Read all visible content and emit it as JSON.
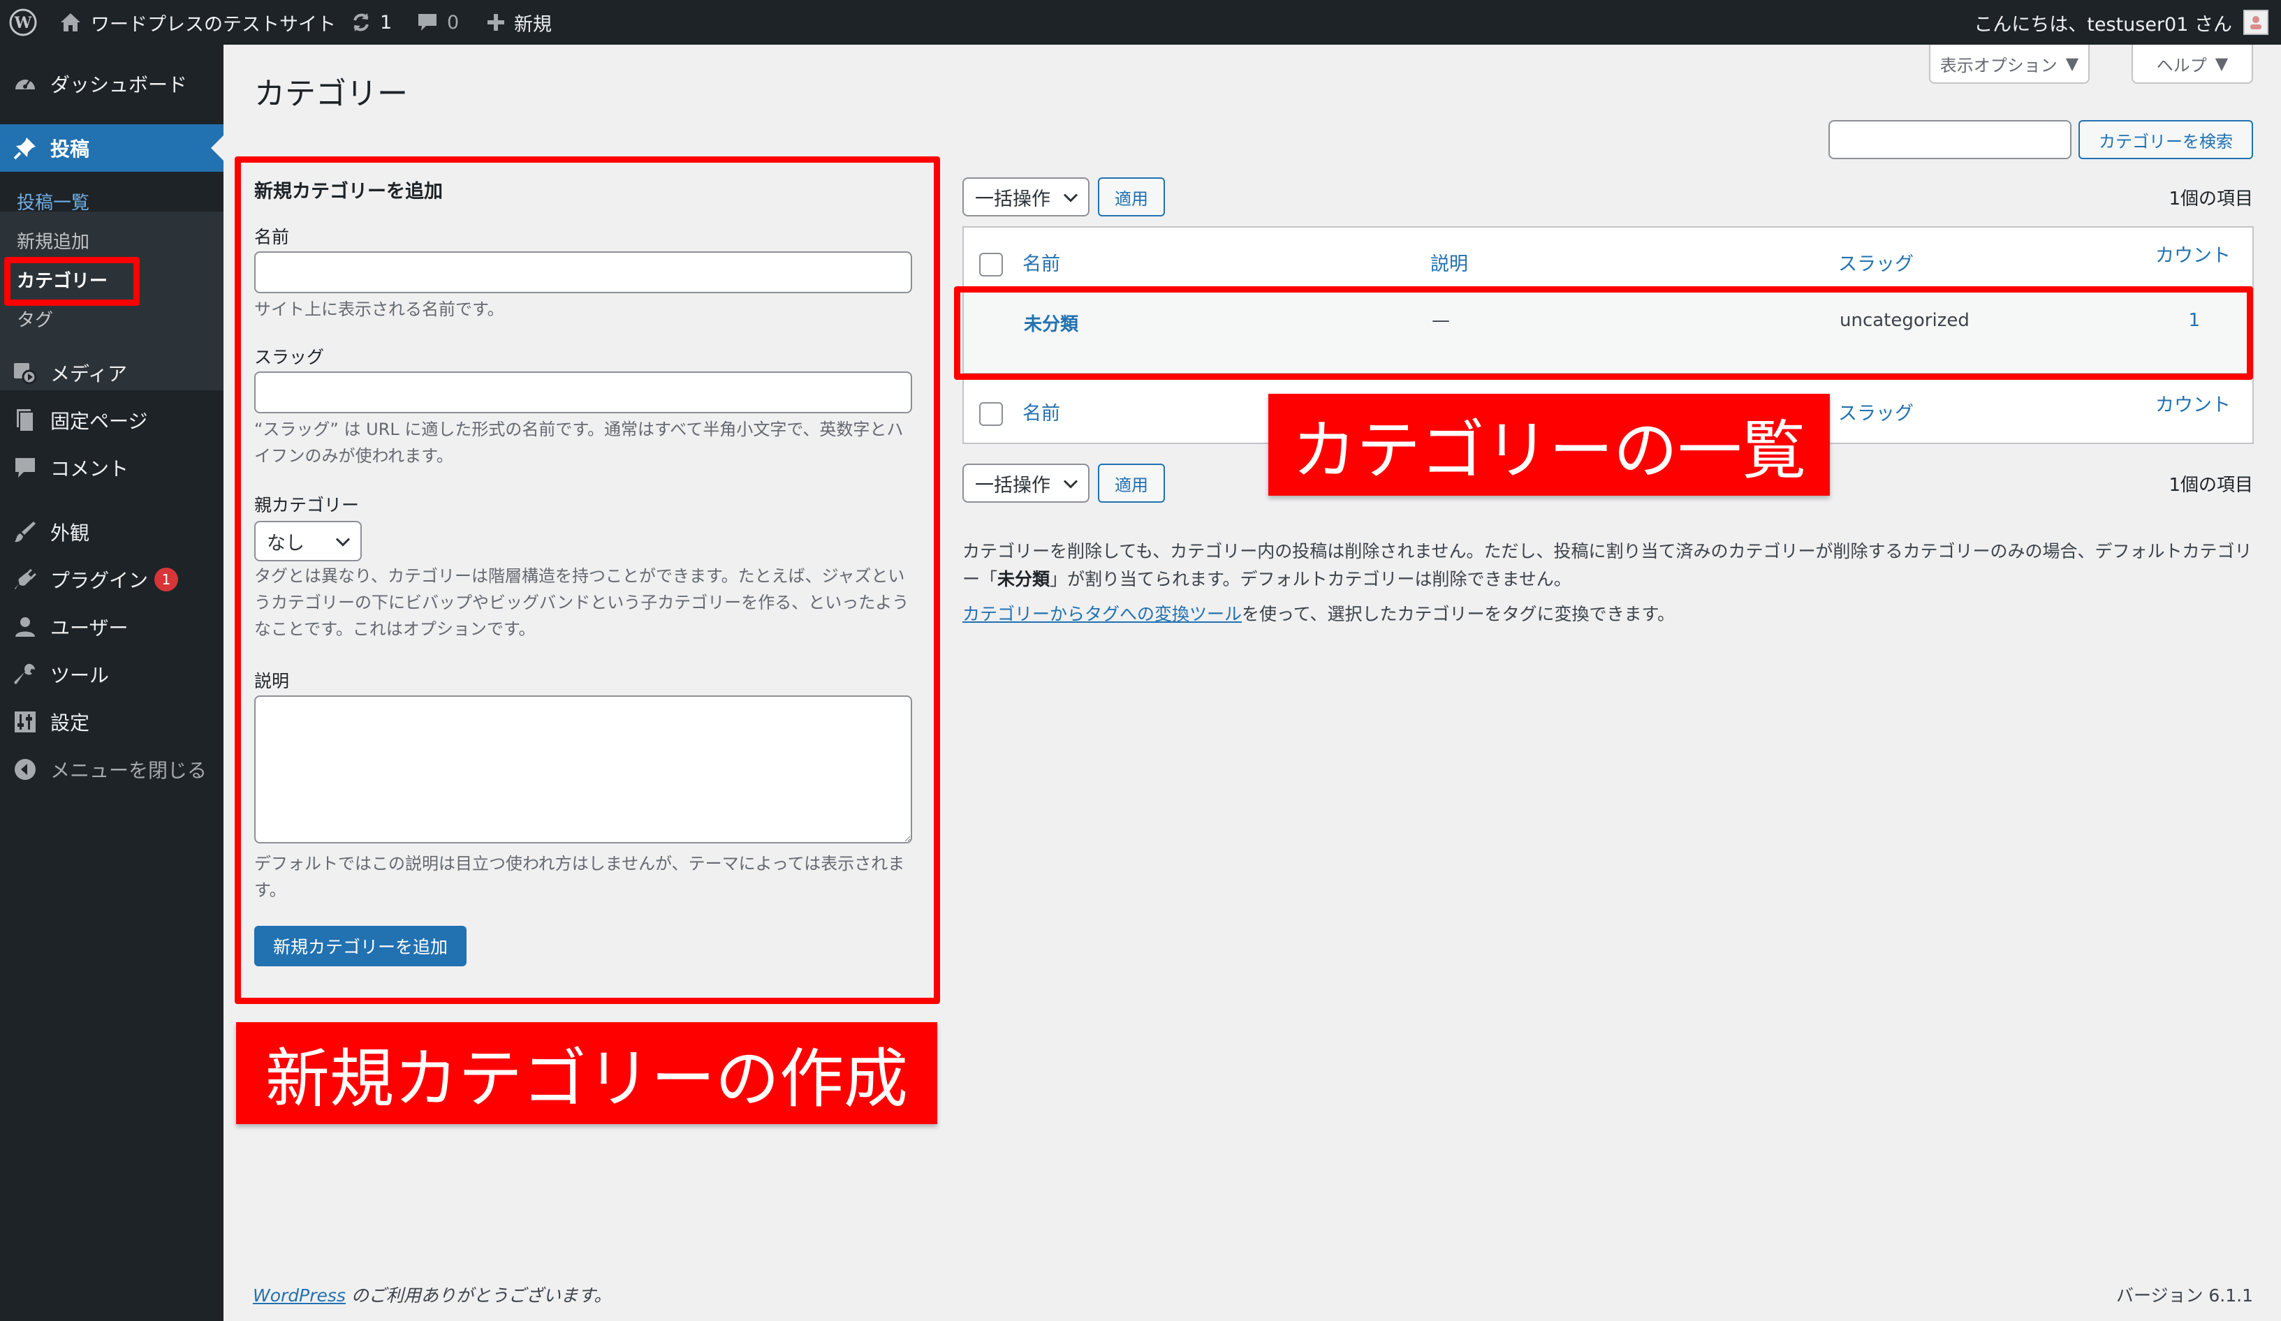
{
  "adminbar": {
    "site_name": "ワードプレスのテストサイト",
    "updates_count": "1",
    "comments_count": "0",
    "new_label": "新規",
    "greeting": "こんにちは、testuser01 さん"
  },
  "sidebar": {
    "items": {
      "dashboard": "ダッシュボード",
      "posts": "投稿",
      "media": "メディア",
      "pages": "固定ページ",
      "comments": "コメント",
      "appearance": "外観",
      "plugins": "プラグイン",
      "users": "ユーザー",
      "tools": "ツール",
      "settings": "設定",
      "collapse": "メニューを閉じる"
    },
    "plugins_badge": "1",
    "submenu": {
      "all_posts": "投稿一覧",
      "add_new": "新規追加",
      "categories": "カテゴリー",
      "tags": "タグ"
    }
  },
  "header": {
    "title": "カテゴリー",
    "screen_options": "表示オプション",
    "help": "ヘルプ"
  },
  "search": {
    "value": "",
    "button": "カテゴリーを検索"
  },
  "form": {
    "heading": "新規カテゴリーを追加",
    "name_label": "名前",
    "name_value": "",
    "name_desc": "サイト上に表示される名前です。",
    "slug_label": "スラッグ",
    "slug_value": "",
    "slug_desc": "“スラッグ” は URL に適した形式の名前です。通常はすべて半角小文字で、英数字とハイフンのみが使われます。",
    "parent_label": "親カテゴリー",
    "parent_selected": "なし",
    "parent_desc": "タグとは異なり、カテゴリーは階層構造を持つことができます。たとえば、ジャズというカテゴリーの下にビバップやビッグバンドという子カテゴリーを作る、といったようなことです。これはオプションです。",
    "description_label": "説明",
    "description_value": "",
    "description_desc": "デフォルトではこの説明は目立つ使われ方はしませんが、テーマによっては表示されます。",
    "submit": "新規カテゴリーを追加"
  },
  "table": {
    "bulk_action": "一括操作",
    "apply": "適用",
    "item_count": "1個の項目",
    "columns": {
      "name": "名前",
      "description": "説明",
      "slug": "スラッグ",
      "count": "カウント"
    },
    "rows": [
      {
        "name": "未分類",
        "description": "—",
        "slug": "uncategorized",
        "count": "1"
      }
    ]
  },
  "notes": {
    "line1_part1": "カテゴリーを削除しても、カテゴリー内の投稿は削除されません。ただし、投稿に割り当て済みのカテゴリーが削除するカテゴリーのみの場合、デフォルトカテゴリー「",
    "line1_bold": "未分類",
    "line1_part2": "」が割り当てられます。デフォルトカテゴリーは削除できません。",
    "link_text": "カテゴリーからタグへの変換ツール",
    "line2_rest": "を使って、選択したカテゴリーをタグに変換できます。"
  },
  "annotations": {
    "list_label": "カテゴリーの一覧",
    "create_label": "新規カテゴリーの作成",
    "color": "#ff0000"
  },
  "footer": {
    "wp_link": "WordPress",
    "thanks": " のご利用ありがとうございます。",
    "version": "バージョン 6.1.1"
  },
  "colors": {
    "adminbar_bg": "#1d2327",
    "menu_current": "#2271b1",
    "link": "#2271b1",
    "page_bg": "#f0f0f1"
  }
}
